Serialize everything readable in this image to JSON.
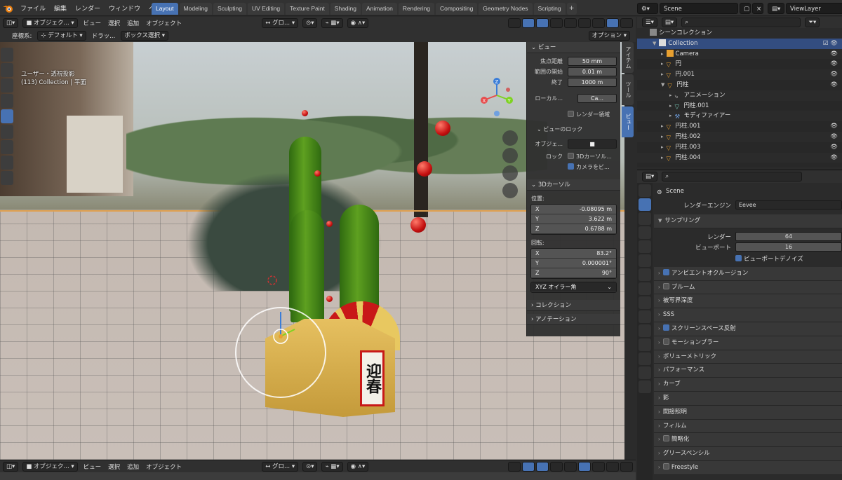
{
  "menu": {
    "items": [
      "ファイル",
      "編集",
      "レンダー",
      "ウィンドウ",
      "ヘルプ"
    ]
  },
  "workspaces": {
    "tabs": [
      "Layout",
      "Modeling",
      "Sculpting",
      "UV Editing",
      "Texture Paint",
      "Shading",
      "Animation",
      "Rendering",
      "Compositing",
      "Geometry Nodes",
      "Scripting"
    ],
    "active": "Layout",
    "add": "+"
  },
  "topright": {
    "scene": "Scene",
    "viewlayer": "ViewLayer"
  },
  "viewport": {
    "mode": "オブジェク...",
    "view": "ビュー",
    "select": "選択",
    "add": "追加",
    "object": "オブジェクト",
    "transform": "グロ...",
    "coord_label": "座標系:",
    "coord_value": "デフォルト",
    "drag_label": "ドラッ...",
    "select_mode": "ボックス選択",
    "options": "オプション",
    "info_line1": "ユーザー・透視投影",
    "info_line2": "(113) Collection | 平面",
    "label_text": "迎春"
  },
  "npanel": {
    "tabs": [
      "アイテム",
      "ツール",
      "ビュー"
    ],
    "view_section": "ビュー",
    "focal_label": "焦点距離",
    "focal_value": "50 mm",
    "clip_start_label": "範囲の開始",
    "clip_start_value": "0.01 m",
    "clip_end_label": "終了",
    "clip_end_value": "1000 m",
    "local_label": "ローカル...",
    "local_value": "Ca...",
    "render_region": "レンダー領域",
    "view_lock": "ビューのロック",
    "lock_object_label": "オブジェ...",
    "lock_label": "ロック",
    "lock_cursor": "3Dカーソル...",
    "lock_camera": "カメラをビ...",
    "cursor_section": "3Dカーソル",
    "location_label": "位置:",
    "loc": [
      {
        "axis": "X",
        "value": "-0.08095 m"
      },
      {
        "axis": "Y",
        "value": "3.622 m"
      },
      {
        "axis": "Z",
        "value": "0.6788 m"
      }
    ],
    "rotation_label": "回転:",
    "rot": [
      {
        "axis": "X",
        "value": "83.2°"
      },
      {
        "axis": "Y",
        "value": "0.000001°"
      },
      {
        "axis": "Z",
        "value": "90°"
      }
    ],
    "rot_mode": "XYZ オイラー角",
    "collection_section": "コレクション",
    "annotation_section": "アノテーション"
  },
  "outliner": {
    "root": "シーンコレクション",
    "items": [
      {
        "name": "Collection",
        "depth": 0
      },
      {
        "name": "Camera",
        "depth": 1
      },
      {
        "name": "円",
        "depth": 1
      },
      {
        "name": "円.001",
        "depth": 1
      },
      {
        "name": "円柱",
        "depth": 1
      },
      {
        "name": "アニメーション",
        "depth": 2
      },
      {
        "name": "円柱.001",
        "depth": 2
      },
      {
        "name": "モディファイアー",
        "depth": 2
      },
      {
        "name": "円柱.001",
        "depth": 1
      },
      {
        "name": "円柱.002",
        "depth": 1
      },
      {
        "name": "円柱.003",
        "depth": 1
      },
      {
        "name": "円柱.004",
        "depth": 1
      }
    ]
  },
  "properties": {
    "scene": "Scene",
    "engine_label": "レンダーエンジン",
    "engine_value": "Eevee",
    "sampling": "サンプリング",
    "render_label": "レンダー",
    "render_value": "64",
    "viewport_label": "ビューポート",
    "viewport_value": "16",
    "denoise": "ビューポートデノイズ",
    "sections": [
      {
        "label": "アンビエントオクルージョン",
        "check": true
      },
      {
        "label": "ブルーム",
        "check": false
      },
      {
        "label": "被写界深度"
      },
      {
        "label": "SSS"
      },
      {
        "label": "スクリーンスペース反射",
        "check": true
      },
      {
        "label": "モーションブラー",
        "check": false
      },
      {
        "label": "ボリューメトリック"
      },
      {
        "label": "パフォーマンス"
      },
      {
        "label": "カーブ"
      },
      {
        "label": "影"
      },
      {
        "label": "間接照明"
      },
      {
        "label": "フィルム"
      },
      {
        "label": "簡略化",
        "check": false
      },
      {
        "label": "グリースペンシル"
      },
      {
        "label": "Freestyle",
        "check": false
      }
    ]
  },
  "colors": {
    "accent": "#4772b3",
    "bg": "#2b2b2b",
    "header": "#303030"
  }
}
